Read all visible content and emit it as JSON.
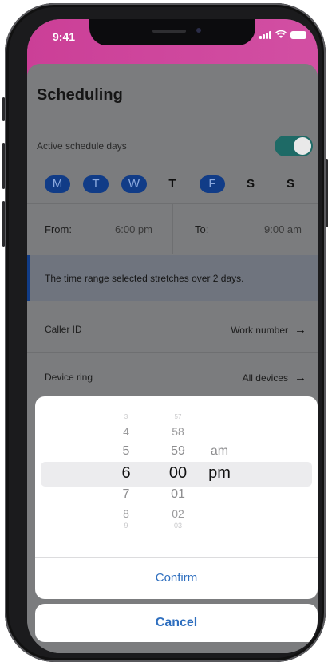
{
  "status": {
    "time": "9:41"
  },
  "page": {
    "title": "Scheduling"
  },
  "active_schedule": {
    "label": "Active schedule days",
    "enabled": true
  },
  "days": [
    {
      "label": "M",
      "selected": true
    },
    {
      "label": "T",
      "selected": true
    },
    {
      "label": "W",
      "selected": true
    },
    {
      "label": "T",
      "selected": false
    },
    {
      "label": "F",
      "selected": true
    },
    {
      "label": "S",
      "selected": false
    },
    {
      "label": "S",
      "selected": false
    }
  ],
  "time_range": {
    "from_label": "From:",
    "from_value": "6:00 pm",
    "to_label": "To:",
    "to_value": "9:00 am"
  },
  "notice": "The time range selected stretches over 2 days.",
  "caller_id": {
    "label": "Caller ID",
    "value": "Work number"
  },
  "device_ring": {
    "label": "Device ring",
    "value": "All devices"
  },
  "picker": {
    "hours": [
      "3",
      "4",
      "5",
      "6",
      "7",
      "8",
      "9"
    ],
    "minutes": [
      "57",
      "58",
      "59",
      "00",
      "01",
      "02",
      "03"
    ],
    "ampm": [
      "am",
      "pm"
    ],
    "selected": {
      "hour": "6",
      "minute": "00",
      "ampm": "pm"
    },
    "confirm_label": "Confirm",
    "cancel_label": "Cancel"
  },
  "colors": {
    "accent_pink": "#cb3f97",
    "selected_day": "#113c87",
    "toggle": "#1e6a66",
    "link_blue": "#2f6fbf"
  },
  "icons": {
    "signal": "cellular-signal-icon",
    "wifi": "wifi-icon",
    "battery": "battery-icon",
    "arrow": "arrow-right-icon"
  }
}
